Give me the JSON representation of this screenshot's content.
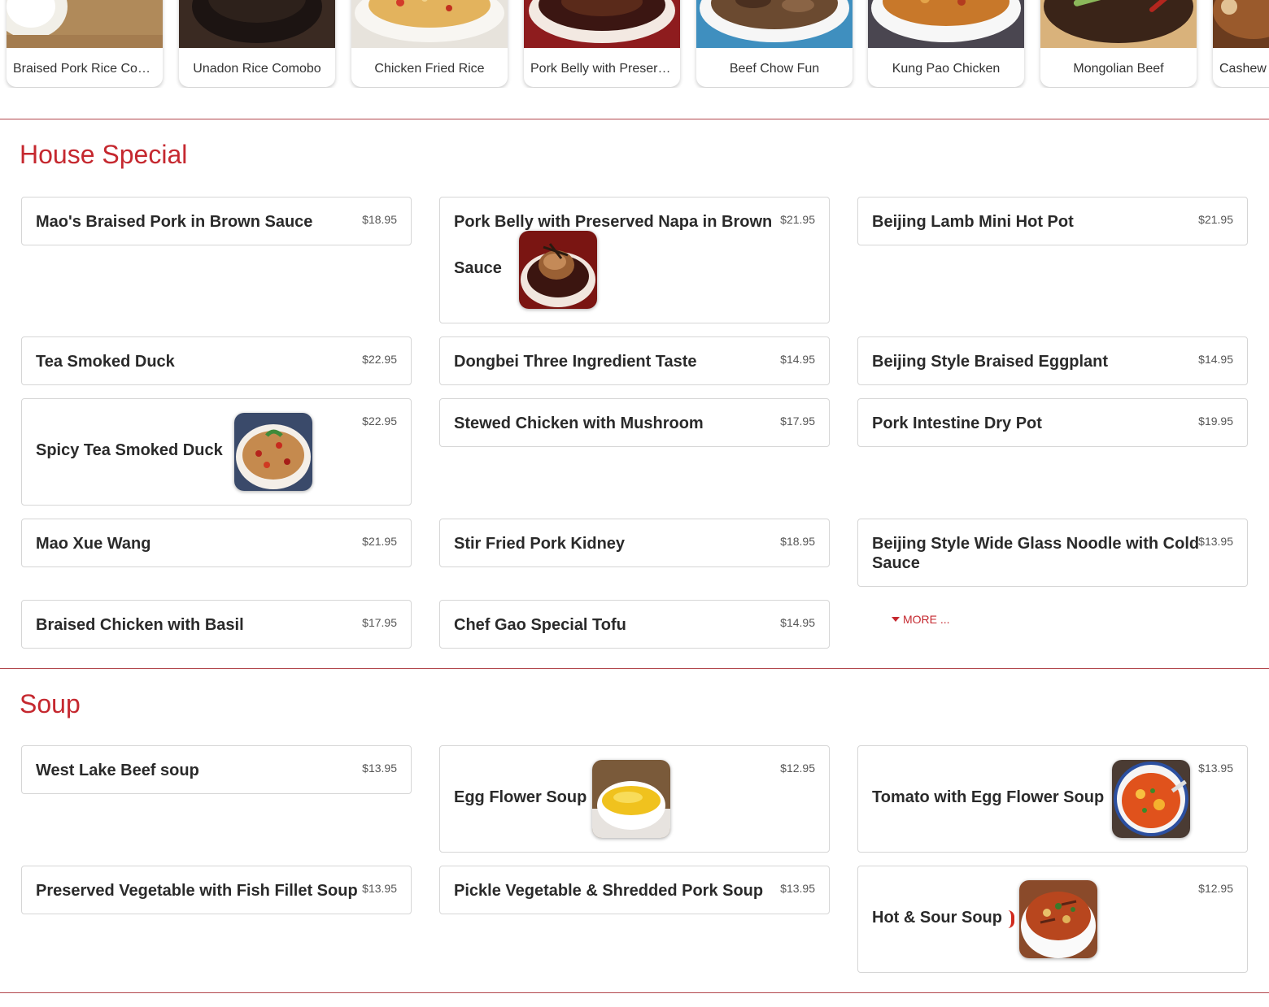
{
  "carousel": {
    "items": [
      {
        "label": "Braised Pork Rice Com..."
      },
      {
        "label": "Unadon Rice Comobo"
      },
      {
        "label": "Chicken Fried Rice"
      },
      {
        "label": "Pork Belly with Preserv..."
      },
      {
        "label": "Beef Chow Fun"
      },
      {
        "label": "Kung Pao Chicken"
      },
      {
        "label": "Mongolian Beef"
      },
      {
        "label": "Cashew"
      }
    ]
  },
  "house_special": {
    "title": "House Special",
    "more_label": "MORE ...",
    "items": [
      {
        "name": "Mao's Braised Pork in Brown Sauce",
        "price": "$18.95"
      },
      {
        "name": "Pork Belly with Preserved Napa in Brown",
        "name_line2": "Sauce",
        "price": "$21.95"
      },
      {
        "name": "Beijing Lamb Mini Hot Pot",
        "price": "$21.95"
      },
      {
        "name": "Tea Smoked Duck",
        "price": "$22.95"
      },
      {
        "name": "Dongbei Three Ingredient Taste",
        "price": "$14.95"
      },
      {
        "name": "Beijing Style Braised Eggplant",
        "price": "$14.95"
      },
      {
        "name": "Spicy Tea Smoked Duck",
        "price": "$22.95"
      },
      {
        "name": "Stewed Chicken with Mushroom",
        "price": "$17.95"
      },
      {
        "name": "Pork Intestine Dry Pot",
        "price": "$19.95"
      },
      {
        "name": "Mao Xue Wang",
        "price": "$21.95"
      },
      {
        "name": "Stir Fried Pork Kidney",
        "price": "$18.95"
      },
      {
        "name": "Beijing Style Wide Glass Noodle with Cold",
        "name_line2": "Sauce",
        "price": "$13.95"
      },
      {
        "name": "Braised Chicken with Basil",
        "price": "$17.95"
      },
      {
        "name": "Chef Gao Special Tofu",
        "price": "$14.95"
      }
    ]
  },
  "soup": {
    "title": "Soup",
    "items": [
      {
        "name": "West Lake Beef soup",
        "price": "$13.95"
      },
      {
        "name": "Egg Flower Soup",
        "price": "$12.95"
      },
      {
        "name": "Tomato with Egg Flower Soup",
        "price": "$13.95"
      },
      {
        "name": "Preserved Vegetable with Fish Fillet Soup",
        "price": "$13.95"
      },
      {
        "name": "Pickle Vegetable & Shredded Pork Soup",
        "price": "$13.95"
      },
      {
        "name": "Hot & Sour Soup",
        "price": "$12.95"
      }
    ]
  },
  "colors": {
    "accent": "#c5282f",
    "rule": "#b2474d",
    "border": "#d6d6d6"
  }
}
